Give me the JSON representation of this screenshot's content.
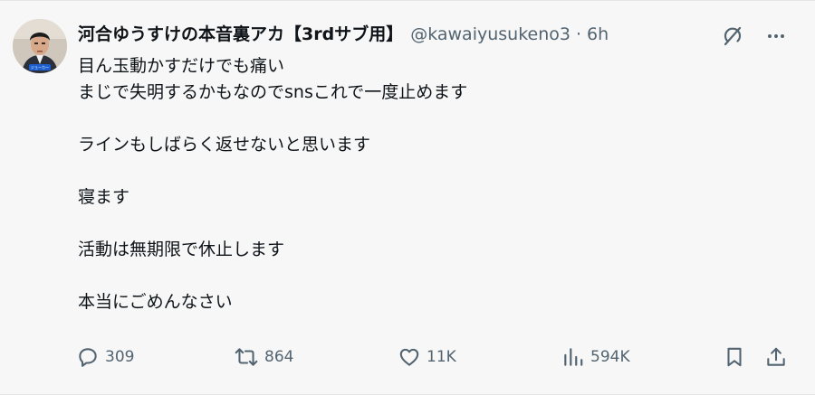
{
  "post": {
    "display_name": "河合ゆうすけの本音裏アカ【3rdサブ用】",
    "handle": "@kawaiyusukeno3",
    "separator": "·",
    "time": "6h",
    "avatar_icon": "user-avatar",
    "avatar_badge_text": "ジョーカー",
    "lines": [
      "目ん玉動かすだけでも痛い",
      "まじで失明するかもなのでsnsこれで一度止めます",
      "",
      "ラインもしばらく返せないと思います",
      "",
      "寝ます",
      "",
      "活動は無期限で休止します",
      "",
      "本当にごめんなさい"
    ]
  },
  "header_icons": {
    "grok": "grok-icon",
    "more": "more-icon"
  },
  "actions": {
    "reply": {
      "icon": "reply-icon",
      "count": "309"
    },
    "repost": {
      "icon": "repost-icon",
      "count": "864"
    },
    "like": {
      "icon": "heart-icon",
      "count": "11K"
    },
    "views": {
      "icon": "views-icon",
      "count": "594K"
    },
    "bookmark": {
      "icon": "bookmark-icon"
    },
    "share": {
      "icon": "share-icon"
    }
  },
  "colors": {
    "background": "#f7f7f7",
    "text": "#0f1419",
    "secondary": "#536471"
  }
}
